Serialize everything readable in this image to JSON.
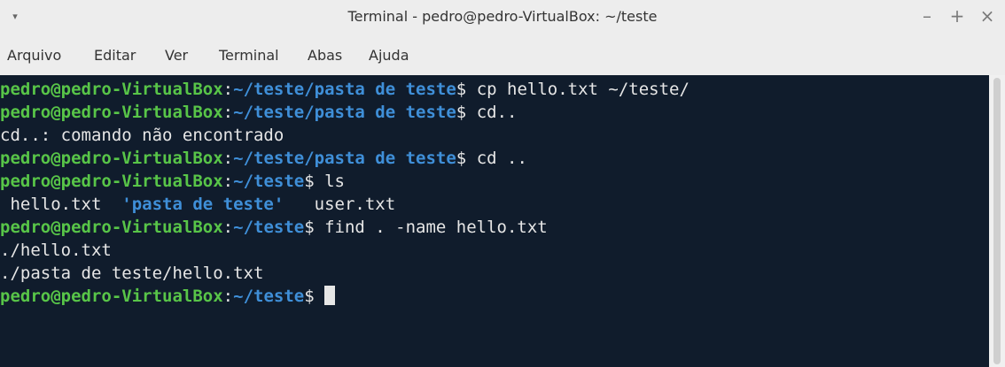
{
  "window": {
    "title": "Terminal - pedro@pedro-VirtualBox: ~/teste",
    "menu_glyph": "▾",
    "minimize_glyph": "–",
    "maximize_glyph": "+",
    "close_glyph": "×"
  },
  "menubar": [
    "Arquivo",
    "Editar",
    "Ver",
    "Terminal",
    "Abas",
    "Ajuda"
  ],
  "terminal": {
    "user_host": "pedro@pedro-VirtualBox",
    "colon": ":",
    "lines": [
      {
        "path": "~/teste/pasta de teste",
        "prompt": "$ ",
        "command": "cp hello.txt ~/teste/"
      },
      {
        "path": "~/teste/pasta de teste",
        "prompt": "$ ",
        "command": "cd.."
      },
      {
        "output": "cd..: comando não encontrado"
      },
      {
        "path": "~/teste/pasta de teste",
        "prompt": "$ ",
        "command": "cd .."
      },
      {
        "path": "~/teste",
        "prompt": "$ ",
        "command": "ls"
      },
      {
        "ls": [
          " hello.txt  ",
          "'pasta de teste'",
          "   user.txt"
        ]
      },
      {
        "path": "~/teste",
        "prompt": "$ ",
        "command": "find . -name hello.txt"
      },
      {
        "output": "./hello.txt"
      },
      {
        "output": "./pasta de teste/hello.txt"
      },
      {
        "path": "~/teste",
        "prompt": "$ ",
        "command": ""
      }
    ]
  },
  "colors": {
    "terminal_bg": "#101c2c",
    "user_host": "#58c548",
    "path": "#3f8fd8",
    "text": "#e6e6e6"
  }
}
